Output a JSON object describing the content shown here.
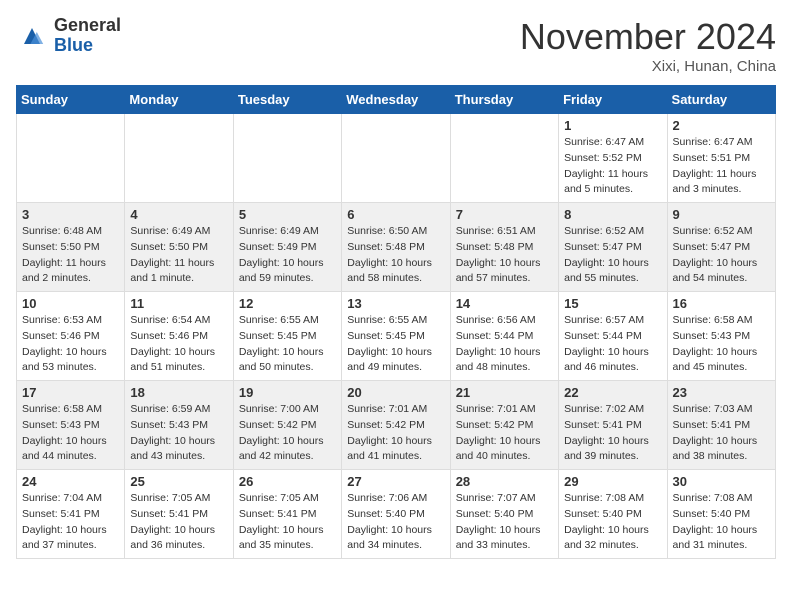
{
  "header": {
    "logo": {
      "general": "General",
      "blue": "Blue"
    },
    "title": "November 2024",
    "location": "Xixi, Hunan, China"
  },
  "calendar": {
    "days_of_week": [
      "Sunday",
      "Monday",
      "Tuesday",
      "Wednesday",
      "Thursday",
      "Friday",
      "Saturday"
    ],
    "weeks": [
      [
        {
          "day": "",
          "info": ""
        },
        {
          "day": "",
          "info": ""
        },
        {
          "day": "",
          "info": ""
        },
        {
          "day": "",
          "info": ""
        },
        {
          "day": "",
          "info": ""
        },
        {
          "day": "1",
          "info": "Sunrise: 6:47 AM\nSunset: 5:52 PM\nDaylight: 11 hours\nand 5 minutes."
        },
        {
          "day": "2",
          "info": "Sunrise: 6:47 AM\nSunset: 5:51 PM\nDaylight: 11 hours\nand 3 minutes."
        }
      ],
      [
        {
          "day": "3",
          "info": "Sunrise: 6:48 AM\nSunset: 5:50 PM\nDaylight: 11 hours\nand 2 minutes."
        },
        {
          "day": "4",
          "info": "Sunrise: 6:49 AM\nSunset: 5:50 PM\nDaylight: 11 hours\nand 1 minute."
        },
        {
          "day": "5",
          "info": "Sunrise: 6:49 AM\nSunset: 5:49 PM\nDaylight: 10 hours\nand 59 minutes."
        },
        {
          "day": "6",
          "info": "Sunrise: 6:50 AM\nSunset: 5:48 PM\nDaylight: 10 hours\nand 58 minutes."
        },
        {
          "day": "7",
          "info": "Sunrise: 6:51 AM\nSunset: 5:48 PM\nDaylight: 10 hours\nand 57 minutes."
        },
        {
          "day": "8",
          "info": "Sunrise: 6:52 AM\nSunset: 5:47 PM\nDaylight: 10 hours\nand 55 minutes."
        },
        {
          "day": "9",
          "info": "Sunrise: 6:52 AM\nSunset: 5:47 PM\nDaylight: 10 hours\nand 54 minutes."
        }
      ],
      [
        {
          "day": "10",
          "info": "Sunrise: 6:53 AM\nSunset: 5:46 PM\nDaylight: 10 hours\nand 53 minutes."
        },
        {
          "day": "11",
          "info": "Sunrise: 6:54 AM\nSunset: 5:46 PM\nDaylight: 10 hours\nand 51 minutes."
        },
        {
          "day": "12",
          "info": "Sunrise: 6:55 AM\nSunset: 5:45 PM\nDaylight: 10 hours\nand 50 minutes."
        },
        {
          "day": "13",
          "info": "Sunrise: 6:55 AM\nSunset: 5:45 PM\nDaylight: 10 hours\nand 49 minutes."
        },
        {
          "day": "14",
          "info": "Sunrise: 6:56 AM\nSunset: 5:44 PM\nDaylight: 10 hours\nand 48 minutes."
        },
        {
          "day": "15",
          "info": "Sunrise: 6:57 AM\nSunset: 5:44 PM\nDaylight: 10 hours\nand 46 minutes."
        },
        {
          "day": "16",
          "info": "Sunrise: 6:58 AM\nSunset: 5:43 PM\nDaylight: 10 hours\nand 45 minutes."
        }
      ],
      [
        {
          "day": "17",
          "info": "Sunrise: 6:58 AM\nSunset: 5:43 PM\nDaylight: 10 hours\nand 44 minutes."
        },
        {
          "day": "18",
          "info": "Sunrise: 6:59 AM\nSunset: 5:43 PM\nDaylight: 10 hours\nand 43 minutes."
        },
        {
          "day": "19",
          "info": "Sunrise: 7:00 AM\nSunset: 5:42 PM\nDaylight: 10 hours\nand 42 minutes."
        },
        {
          "day": "20",
          "info": "Sunrise: 7:01 AM\nSunset: 5:42 PM\nDaylight: 10 hours\nand 41 minutes."
        },
        {
          "day": "21",
          "info": "Sunrise: 7:01 AM\nSunset: 5:42 PM\nDaylight: 10 hours\nand 40 minutes."
        },
        {
          "day": "22",
          "info": "Sunrise: 7:02 AM\nSunset: 5:41 PM\nDaylight: 10 hours\nand 39 minutes."
        },
        {
          "day": "23",
          "info": "Sunrise: 7:03 AM\nSunset: 5:41 PM\nDaylight: 10 hours\nand 38 minutes."
        }
      ],
      [
        {
          "day": "24",
          "info": "Sunrise: 7:04 AM\nSunset: 5:41 PM\nDaylight: 10 hours\nand 37 minutes."
        },
        {
          "day": "25",
          "info": "Sunrise: 7:05 AM\nSunset: 5:41 PM\nDaylight: 10 hours\nand 36 minutes."
        },
        {
          "day": "26",
          "info": "Sunrise: 7:05 AM\nSunset: 5:41 PM\nDaylight: 10 hours\nand 35 minutes."
        },
        {
          "day": "27",
          "info": "Sunrise: 7:06 AM\nSunset: 5:40 PM\nDaylight: 10 hours\nand 34 minutes."
        },
        {
          "day": "28",
          "info": "Sunrise: 7:07 AM\nSunset: 5:40 PM\nDaylight: 10 hours\nand 33 minutes."
        },
        {
          "day": "29",
          "info": "Sunrise: 7:08 AM\nSunset: 5:40 PM\nDaylight: 10 hours\nand 32 minutes."
        },
        {
          "day": "30",
          "info": "Sunrise: 7:08 AM\nSunset: 5:40 PM\nDaylight: 10 hours\nand 31 minutes."
        }
      ]
    ]
  }
}
